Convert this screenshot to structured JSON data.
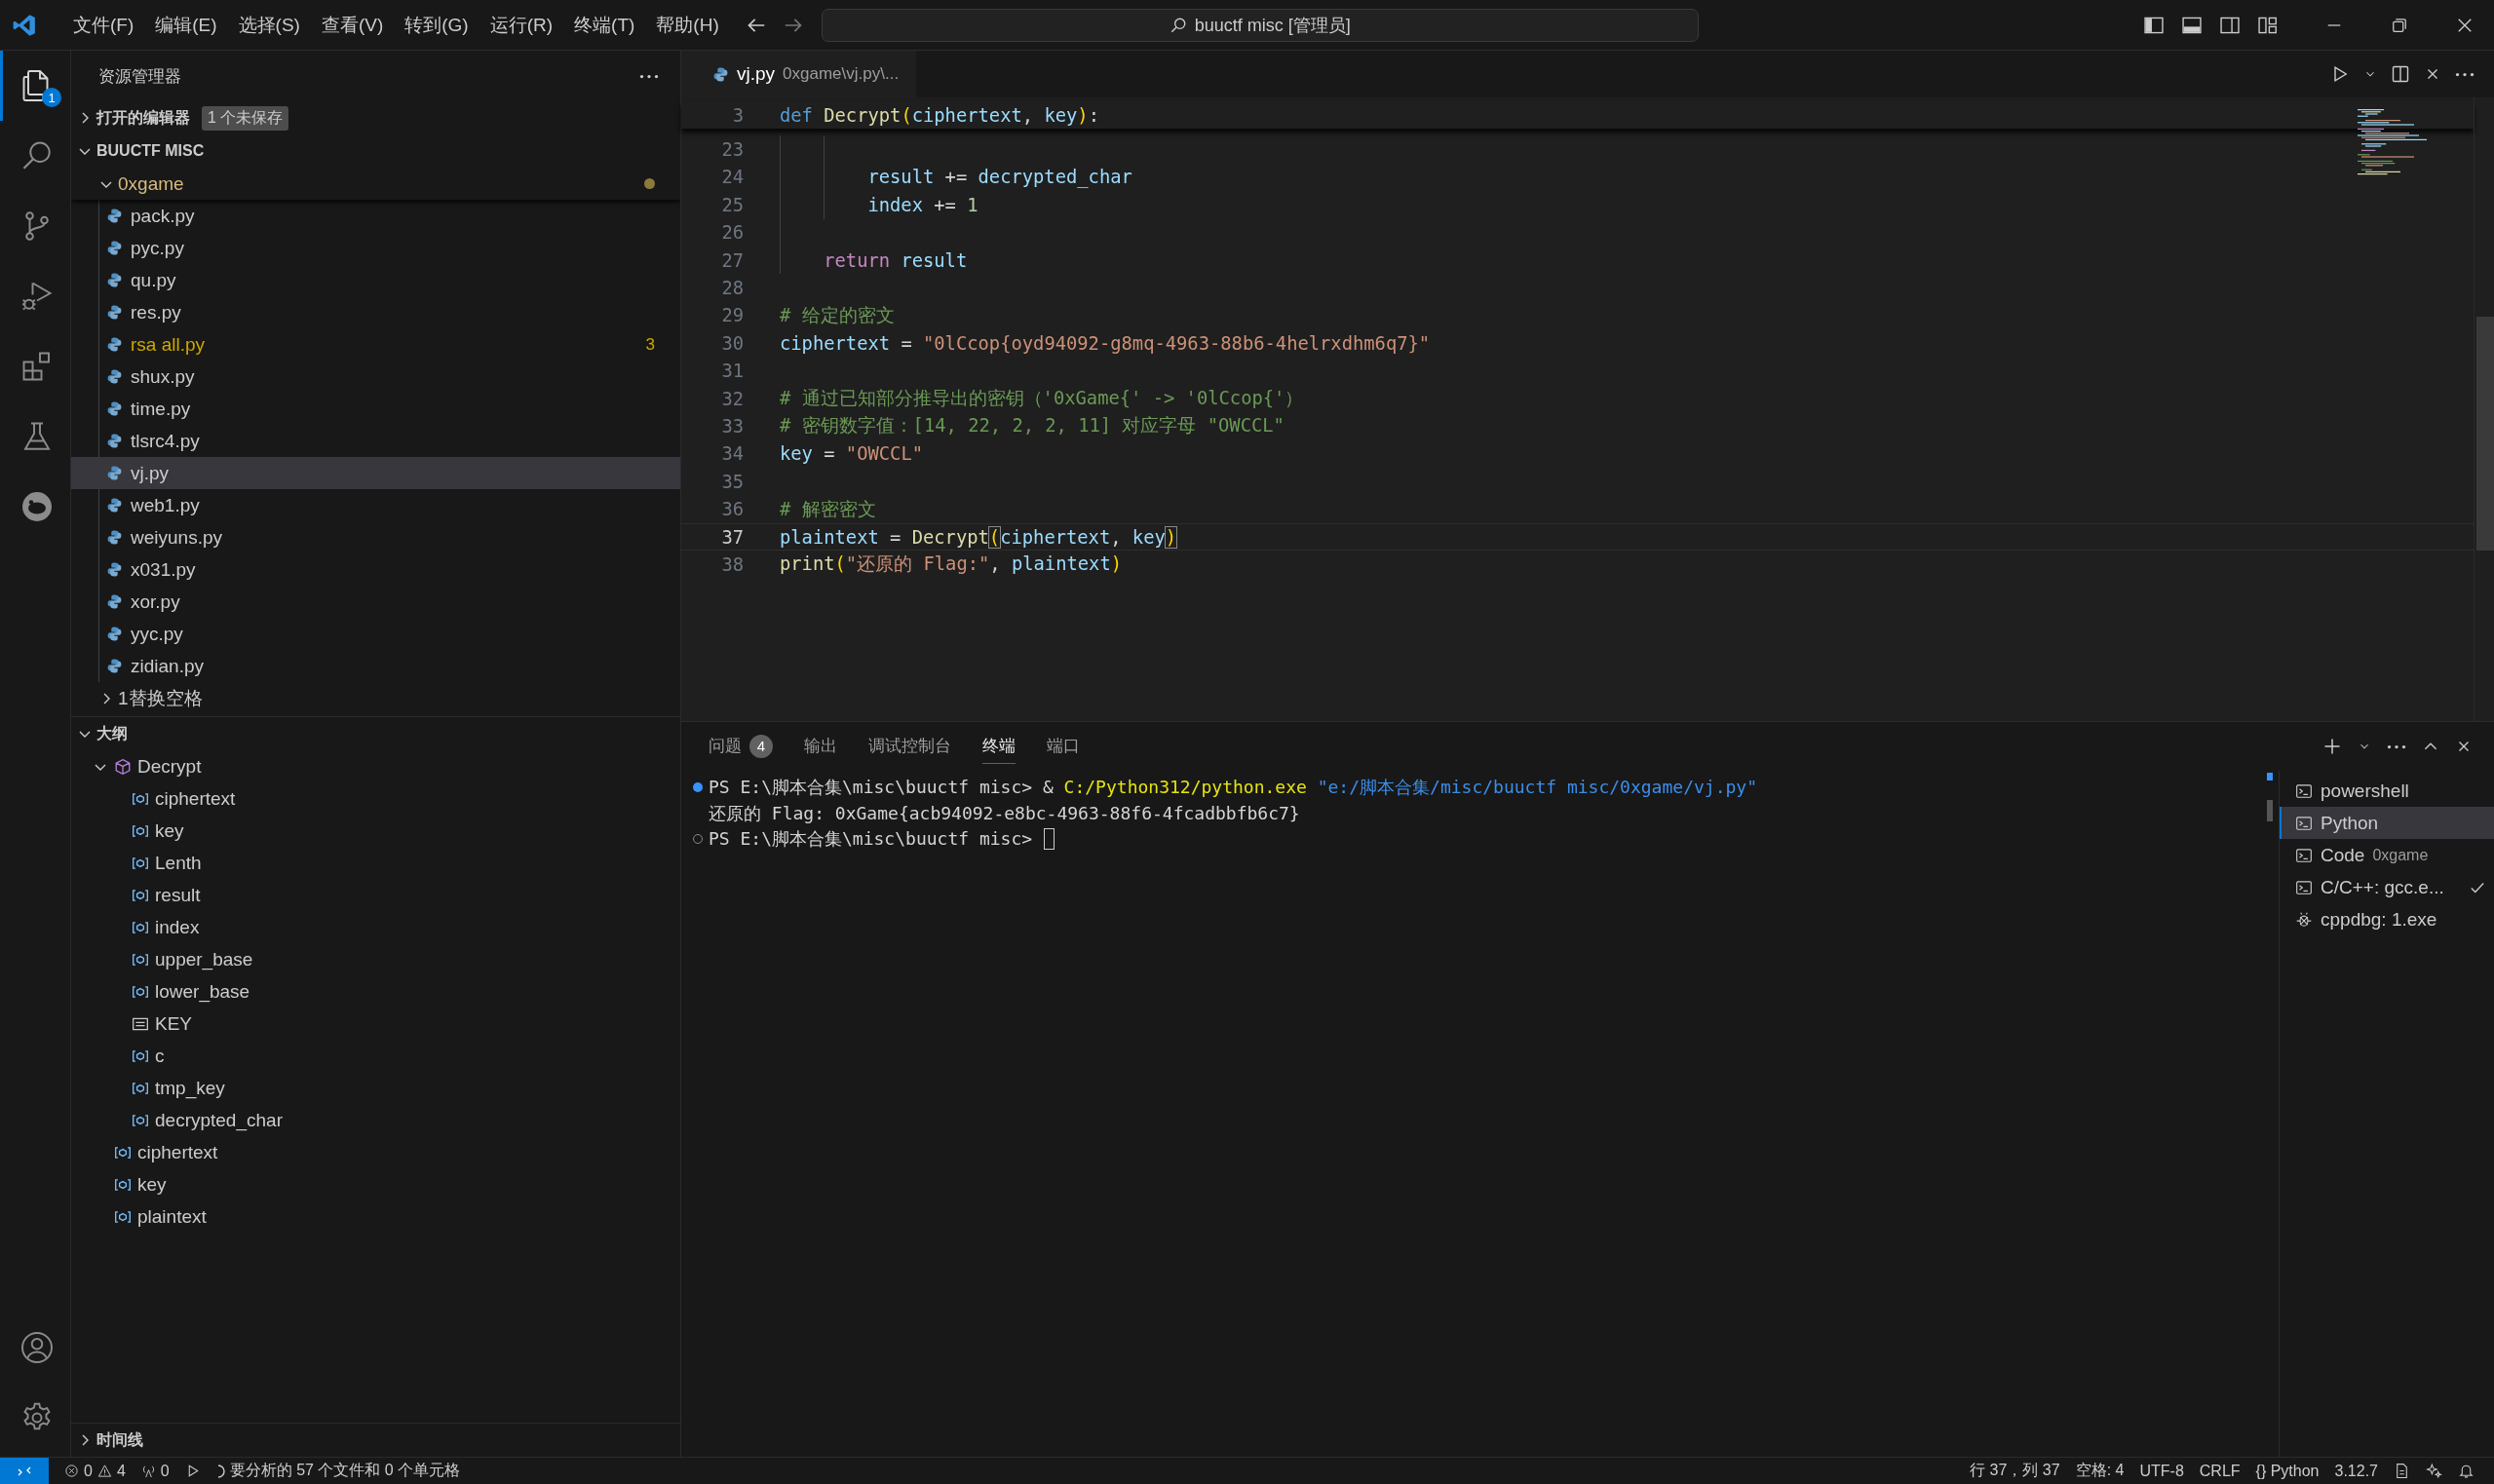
{
  "title_bar": {
    "menus": [
      "文件(F)",
      "编辑(E)",
      "选择(S)",
      "查看(V)",
      "转到(G)",
      "运行(R)",
      "终端(T)",
      "帮助(H)"
    ],
    "command_center": "buuctf misc [管理员]"
  },
  "activity_bar": {
    "top": [
      {
        "kind": "explorer",
        "selected": true,
        "badge": "1"
      },
      {
        "kind": "search",
        "selected": false
      },
      {
        "kind": "source-control",
        "selected": false
      },
      {
        "kind": "run-debug",
        "selected": false
      },
      {
        "kind": "extensions",
        "selected": false
      },
      {
        "kind": "testing",
        "selected": false
      },
      {
        "kind": "round-logo",
        "selected": false
      }
    ],
    "bottom": [
      {
        "kind": "account",
        "selected": false
      },
      {
        "kind": "settings",
        "selected": false
      }
    ]
  },
  "sidebar": {
    "title": "资源管理器",
    "open_editors": {
      "label": "打开的编辑器",
      "expanded": false,
      "badge": "1 个未保存"
    },
    "workspace": {
      "label": "BUUCTF MISC",
      "expanded": true
    },
    "folder": {
      "name": "0xgame",
      "expanded": true,
      "modified": true
    },
    "files": [
      {
        "name": "pack.py",
        "selected": false,
        "warning": false
      },
      {
        "name": "pyc.py",
        "selected": false,
        "warning": false
      },
      {
        "name": "qu.py",
        "selected": false,
        "warning": false
      },
      {
        "name": "res.py",
        "selected": false,
        "warning": false
      },
      {
        "name": "rsa all.py",
        "selected": false,
        "warning": true,
        "count": "3"
      },
      {
        "name": "shux.py",
        "selected": false,
        "warning": false
      },
      {
        "name": "time.py",
        "selected": false,
        "warning": false
      },
      {
        "name": "tlsrc4.py",
        "selected": false,
        "warning": false
      },
      {
        "name": "vj.py",
        "selected": true,
        "warning": false
      },
      {
        "name": "web1.py",
        "selected": false,
        "warning": false
      },
      {
        "name": "weiyuns.py",
        "selected": false,
        "warning": false
      },
      {
        "name": "x031.py",
        "selected": false,
        "warning": false
      },
      {
        "name": "xor.py",
        "selected": false,
        "warning": false
      },
      {
        "name": "yyc.py",
        "selected": false,
        "warning": false
      },
      {
        "name": "zidian.py",
        "selected": false,
        "warning": false
      }
    ],
    "subfolders": [
      {
        "name": "1替换空格",
        "expanded": false
      }
    ],
    "outline": {
      "label": "大纲",
      "expanded": true,
      "items": [
        {
          "name": "Decrypt",
          "kind": "function",
          "expanded": true,
          "children": [
            {
              "name": "ciphertext",
              "kind": "variable"
            },
            {
              "name": "key",
              "kind": "variable"
            },
            {
              "name": "Lenth",
              "kind": "variable"
            },
            {
              "name": "result",
              "kind": "variable"
            },
            {
              "name": "index",
              "kind": "variable"
            },
            {
              "name": "upper_base",
              "kind": "variable"
            },
            {
              "name": "lower_base",
              "kind": "variable"
            },
            {
              "name": "KEY",
              "kind": "constant"
            },
            {
              "name": "c",
              "kind": "variable"
            },
            {
              "name": "tmp_key",
              "kind": "variable"
            },
            {
              "name": "decrypted_char",
              "kind": "variable"
            }
          ]
        },
        {
          "name": "ciphertext",
          "kind": "variable"
        },
        {
          "name": "key",
          "kind": "variable"
        },
        {
          "name": "plaintext",
          "kind": "variable"
        }
      ]
    },
    "timeline": {
      "label": "时间线",
      "expanded": false
    }
  },
  "editor": {
    "tab": {
      "name": "vj.py",
      "description": "0xgame\\vj.py\\..."
    },
    "sticky_line": {
      "number": "3",
      "tokens": [
        {
          "kind": "kw",
          "text": "def "
        },
        {
          "kind": "fn",
          "text": "Decrypt"
        },
        {
          "kind": "br",
          "text": "("
        },
        {
          "kind": "var",
          "text": "ciphertext"
        },
        {
          "kind": "p",
          "text": ", "
        },
        {
          "kind": "var",
          "text": "key"
        },
        {
          "kind": "br",
          "text": ")"
        },
        {
          "kind": "p",
          "text": ":"
        }
      ]
    },
    "lines": [
      {
        "number": "23",
        "current": false,
        "in_function": true,
        "in_loop": true
      },
      {
        "number": "24",
        "current": false,
        "in_function": true,
        "in_loop": true,
        "tokens": [
          {
            "kind": "var",
            "text": "result"
          },
          {
            "kind": "p",
            "text": " += "
          },
          {
            "kind": "var",
            "text": "decrypted_char"
          }
        ]
      },
      {
        "number": "25",
        "current": false,
        "in_function": true,
        "in_loop": true,
        "tokens": [
          {
            "kind": "var",
            "text": "index"
          },
          {
            "kind": "p",
            "text": " += "
          },
          {
            "kind": "num",
            "text": "1"
          }
        ]
      },
      {
        "number": "26",
        "current": false,
        "in_function": true,
        "in_loop": false
      },
      {
        "number": "27",
        "current": false,
        "in_function": true,
        "in_loop": false,
        "tokens": [
          {
            "kind": "ctrl",
            "text": "return "
          },
          {
            "kind": "var",
            "text": "result"
          }
        ]
      },
      {
        "number": "28",
        "current": false
      },
      {
        "number": "29",
        "current": false,
        "tokens": [
          {
            "kind": "com",
            "text": "# 给定的密文"
          }
        ]
      },
      {
        "number": "30",
        "current": false,
        "tokens": [
          {
            "kind": "var",
            "text": "ciphertext"
          },
          {
            "kind": "p",
            "text": " = "
          },
          {
            "kind": "str",
            "text": "\"0lCcop{oyd94092-g8mq-4963-88b6-4helrxdhm6q7}\""
          }
        ]
      },
      {
        "number": "31",
        "current": false
      },
      {
        "number": "32",
        "current": false,
        "tokens": [
          {
            "kind": "com",
            "text": "# 通过已知部分推导出的密钥（'0xGame{' -> '0lCcop{'）"
          }
        ]
      },
      {
        "number": "33",
        "current": false,
        "tokens": [
          {
            "kind": "com",
            "text": "# 密钥数字值：[14, 22, 2, 2, 11] 对应字母 \"OWCCL\""
          }
        ]
      },
      {
        "number": "34",
        "current": false,
        "tokens": [
          {
            "kind": "var",
            "text": "key"
          },
          {
            "kind": "p",
            "text": " = "
          },
          {
            "kind": "str",
            "text": "\"OWCCL\""
          }
        ]
      },
      {
        "number": "35",
        "current": false
      },
      {
        "number": "36",
        "current": false,
        "tokens": [
          {
            "kind": "com",
            "text": "# 解密密文"
          }
        ]
      },
      {
        "number": "37",
        "current": true,
        "tokens": [
          {
            "kind": "var",
            "text": "plaintext"
          },
          {
            "kind": "p",
            "text": " = "
          },
          {
            "kind": "fn",
            "text": "Decrypt"
          },
          {
            "kind": "match",
            "text": "("
          },
          {
            "kind": "var",
            "text": "ciphertext"
          },
          {
            "kind": "p",
            "text": ", "
          },
          {
            "kind": "var",
            "text": "key"
          },
          {
            "kind": "match",
            "text": ")"
          }
        ]
      },
      {
        "number": "38",
        "current": false,
        "tokens": [
          {
            "kind": "fn",
            "text": "print"
          },
          {
            "kind": "br",
            "text": "("
          },
          {
            "kind": "str",
            "text": "\"还原的 Flag:\""
          },
          {
            "kind": "p",
            "text": ", "
          },
          {
            "kind": "var",
            "text": "plaintext"
          },
          {
            "kind": "br",
            "text": ")"
          }
        ]
      }
    ]
  },
  "panel": {
    "tabs": [
      {
        "label": "问题",
        "badge": "4",
        "selected": false
      },
      {
        "label": "输出",
        "selected": false
      },
      {
        "label": "调试控制台",
        "selected": false
      },
      {
        "label": "终端",
        "selected": true
      },
      {
        "label": "端口",
        "selected": false
      }
    ],
    "terminal_lines": [
      {
        "command_done": true,
        "command_pending": false,
        "cursor": false,
        "tokens": [
          {
            "kind": "p",
            "text": "PS E:\\脚本合集\\misc\\buuctf misc> & "
          },
          {
            "kind": "cmd",
            "text": "C:/Python312/python.exe"
          },
          {
            "kind": "arg",
            "text": " \"e:/脚本合集/misc/buuctf misc/0xgame/vj.py\""
          }
        ]
      },
      {
        "command_done": false,
        "command_pending": false,
        "cursor": false,
        "tokens": [
          {
            "kind": "p",
            "text": "还原的 Flag: 0xGame{acb94092-e8bc-4963-88f6-4fcadbbfb6c7}"
          }
        ]
      },
      {
        "command_done": false,
        "command_pending": true,
        "cursor": true,
        "tokens": [
          {
            "kind": "p",
            "text": "PS E:\\脚本合集\\misc\\buuctf misc> "
          }
        ]
      }
    ],
    "terminals": [
      {
        "kind": "shell",
        "name": "powershell",
        "selected": false,
        "done": false
      },
      {
        "kind": "shell",
        "name": "Python",
        "selected": true,
        "done": false
      },
      {
        "kind": "shell",
        "name": "Code",
        "detail": "0xgame",
        "selected": false,
        "done": false
      },
      {
        "kind": "shell",
        "name": "C/C++: gcc.e...",
        "selected": false,
        "done": true
      },
      {
        "kind": "debug",
        "name": "cppdbg: 1.exe",
        "selected": false,
        "done": false
      }
    ]
  },
  "status_bar": {
    "errors": "0",
    "warnings": "4",
    "ports": "0",
    "analysis": "要分析的 57 个文件和 0 个单元格",
    "position": "行 37，列 37",
    "indent": "空格: 4",
    "encoding": "UTF-8",
    "eol": "CRLF",
    "language_braces": "{}",
    "language": "Python",
    "version": "3.12.7"
  }
}
